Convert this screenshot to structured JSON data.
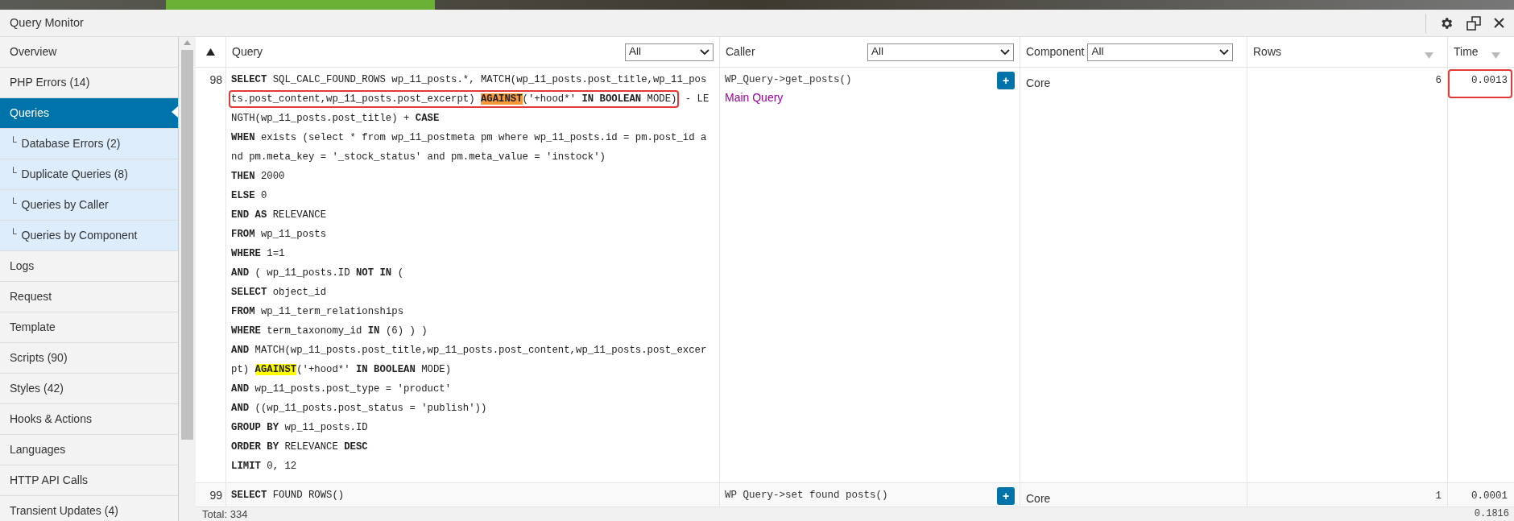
{
  "panel": {
    "title": "Query Monitor"
  },
  "sidebar": {
    "items": [
      {
        "label": "Overview",
        "selected": false
      },
      {
        "label": "PHP Errors (14)",
        "selected": false
      },
      {
        "label": "Queries",
        "selected": true,
        "children": [
          {
            "branch": "└",
            "label": "Database Errors (2)",
            "selected": false
          },
          {
            "branch": "└",
            "label": "Duplicate Queries (8)",
            "selected": false
          },
          {
            "branch": "└",
            "label": "Queries by Caller",
            "selected": false
          },
          {
            "branch": "└",
            "label": "Queries by Component",
            "selected": false
          }
        ]
      },
      {
        "label": "Logs",
        "selected": false
      },
      {
        "label": "Request",
        "selected": false
      },
      {
        "label": "Template",
        "selected": false
      },
      {
        "label": "Scripts (90)",
        "selected": false
      },
      {
        "label": "Styles (42)",
        "selected": false
      },
      {
        "label": "Hooks & Actions",
        "selected": false
      },
      {
        "label": "Languages",
        "selected": false
      },
      {
        "label": "HTTP API Calls",
        "selected": false
      },
      {
        "label": "Transient Updates (4)",
        "selected": false
      }
    ]
  },
  "table": {
    "number_column": {
      "sorted": true
    },
    "columns": [
      {
        "label": "Query",
        "filter": "All"
      },
      {
        "label": "Caller",
        "filter": "All"
      },
      {
        "label": "Component",
        "filter": "All"
      },
      {
        "label": "Rows",
        "sorted": false
      },
      {
        "label": "Time",
        "sorted": false
      }
    ],
    "rows": [
      {
        "number": "98",
        "query_lines": [
          {
            "segments": [
              {
                "text": "SELECT",
                "kind": "keyword"
              },
              {
                "text": " SQL_CALC_FOUND_ROWS wp_11_posts.*, MATCH(wp_11_posts.post_title,wp_11_pos",
                "kind": "plain"
              }
            ]
          },
          {
            "boxed": [
              {
                "text": "ts.post_content,wp_11_posts.post_excerpt) ",
                "kind": "plain"
              },
              {
                "text": "AGAINST",
                "kind": "match",
                "color": "#f7983a"
              },
              {
                "text": "('+hood*' ",
                "kind": "plain"
              },
              {
                "text": "IN BOOLEAN",
                "kind": "keyword"
              },
              {
                "text": " MODE)",
                "kind": "plain"
              }
            ],
            "segments": [
              {
                "text": " - LE",
                "kind": "plain"
              }
            ]
          },
          {
            "segments": [
              {
                "text": "NGTH(wp_11_posts.post_title) + ",
                "kind": "plain"
              },
              {
                "text": "CASE",
                "kind": "keyword"
              }
            ]
          },
          {
            "segments": [
              {
                "text": "WHEN",
                "kind": "keyword"
              },
              {
                "text": " exists (select * from wp_11_postmeta pm where wp_11_posts.id = pm.post_id a",
                "kind": "plain"
              }
            ]
          },
          {
            "segments": [
              {
                "text": "nd pm.meta_key = '_stock_status' and pm.meta_value = 'instock')",
                "kind": "plain"
              }
            ]
          },
          {
            "segments": [
              {
                "text": "THEN",
                "kind": "keyword"
              },
              {
                "text": " 2000",
                "kind": "plain"
              }
            ]
          },
          {
            "segments": [
              {
                "text": "ELSE",
                "kind": "keyword"
              },
              {
                "text": " 0",
                "kind": "plain"
              }
            ]
          },
          {
            "segments": [
              {
                "text": "END AS",
                "kind": "keyword"
              },
              {
                "text": " RELEVANCE",
                "kind": "plain"
              }
            ]
          },
          {
            "segments": [
              {
                "text": "FROM",
                "kind": "keyword"
              },
              {
                "text": " wp_11_posts",
                "kind": "plain"
              }
            ]
          },
          {
            "segments": [
              {
                "text": "WHERE",
                "kind": "keyword"
              },
              {
                "text": " 1=1",
                "kind": "plain"
              }
            ]
          },
          {
            "segments": [
              {
                "text": "AND",
                "kind": "keyword"
              },
              {
                "text": " ( wp_11_posts.ID ",
                "kind": "plain"
              },
              {
                "text": "NOT IN",
                "kind": "keyword"
              },
              {
                "text": " (",
                "kind": "plain"
              }
            ]
          },
          {
            "segments": [
              {
                "text": "SELECT",
                "kind": "keyword"
              },
              {
                "text": " object_id",
                "kind": "plain"
              }
            ]
          },
          {
            "segments": [
              {
                "text": "FROM",
                "kind": "keyword"
              },
              {
                "text": " wp_11_term_relationships",
                "kind": "plain"
              }
            ]
          },
          {
            "segments": [
              {
                "text": "WHERE",
                "kind": "keyword"
              },
              {
                "text": " term_taxonomy_id ",
                "kind": "plain"
              },
              {
                "text": "IN",
                "kind": "keyword"
              },
              {
                "text": " (6) ) )",
                "kind": "plain"
              }
            ]
          },
          {
            "segments": [
              {
                "text": "AND",
                "kind": "keyword"
              },
              {
                "text": " MATCH(wp_11_posts.post_title,wp_11_posts.post_content,wp_11_posts.post_excer",
                "kind": "plain"
              }
            ]
          },
          {
            "segments": [
              {
                "text": "pt) ",
                "kind": "plain"
              },
              {
                "text": "AGAINST",
                "kind": "match",
                "color": "#ffff00"
              },
              {
                "text": "('+hood*' ",
                "kind": "plain"
              },
              {
                "text": "IN BOOLEAN",
                "kind": "keyword"
              },
              {
                "text": " MODE)",
                "kind": "plain"
              }
            ]
          },
          {
            "segments": [
              {
                "text": "AND",
                "kind": "keyword"
              },
              {
                "text": " wp_11_posts.post_type = 'product'",
                "kind": "plain"
              }
            ]
          },
          {
            "segments": [
              {
                "text": "AND",
                "kind": "keyword"
              },
              {
                "text": " ((wp_11_posts.post_status = 'publish'))",
                "kind": "plain"
              }
            ]
          },
          {
            "segments": [
              {
                "text": "GROUP BY",
                "kind": "keyword"
              },
              {
                "text": " wp_11_posts.ID",
                "kind": "plain"
              }
            ]
          },
          {
            "segments": [
              {
                "text": "ORDER BY",
                "kind": "keyword"
              },
              {
                "text": " RELEVANCE ",
                "kind": "plain"
              },
              {
                "text": "DESC",
                "kind": "keyword"
              }
            ]
          },
          {
            "segments": [
              {
                "text": "LIMIT",
                "kind": "keyword"
              },
              {
                "text": " 0, 12",
                "kind": "plain"
              }
            ]
          }
        ],
        "caller": "WP_Query->get_posts()",
        "caller_note": "Main Query",
        "button": "+",
        "component": "Core",
        "rows": "6",
        "time": "0.0013",
        "time_annotated": true
      },
      {
        "number": "99",
        "query_lines": [
          {
            "segments": [
              {
                "text": "SELECT",
                "kind": "keyword"
              },
              {
                "text": " FOUND ROWS()",
                "kind": "plain"
              }
            ]
          }
        ],
        "caller": "WP Query->set found posts()",
        "button": "+",
        "component": "Core",
        "rows": "1",
        "time": "0.0001",
        "time_annotated": false
      }
    ],
    "footer": {
      "total": "Total: 334",
      "time": "0.1816"
    }
  }
}
